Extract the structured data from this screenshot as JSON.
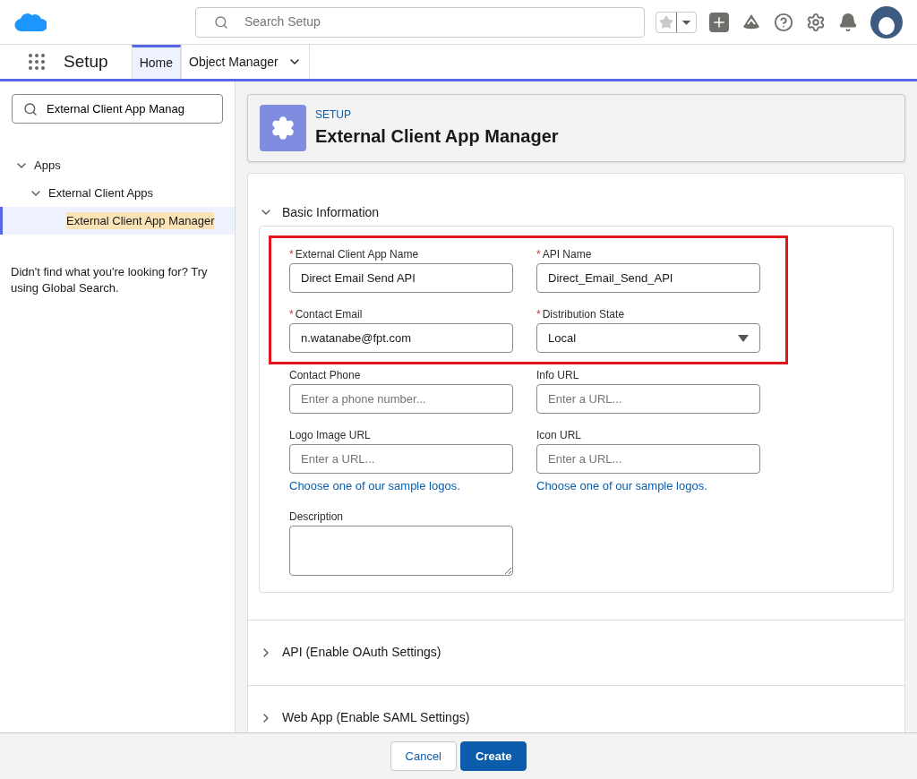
{
  "header": {
    "search": {
      "placeholder": "Search Setup"
    }
  },
  "nav": {
    "app_name": "Setup",
    "tabs": [
      {
        "label": "Home",
        "selected": true,
        "has_menu": false
      },
      {
        "label": "Object Manager",
        "selected": false,
        "has_menu": true
      }
    ]
  },
  "sidebar": {
    "search": {
      "value": "External Client App Manag"
    },
    "tree": [
      {
        "label": "Apps",
        "expanded": true,
        "selected": false,
        "children": [
          {
            "label": "External Client Apps",
            "expanded": true,
            "selected": false,
            "children": [
              {
                "label": "External Client App Manager",
                "selected": true
              }
            ]
          }
        ]
      }
    ],
    "help_text": "Didn't find what you're looking for? Try using Global Search."
  },
  "page_header": {
    "eyebrow": "SETUP",
    "title": "External Client App Manager"
  },
  "sections": [
    {
      "title": "Basic Information",
      "expanded": true,
      "groups": [
        {
          "highlighted": true,
          "rows": [
            [
              {
                "kind": "text",
                "label": "External Client App Name",
                "required_mark": "*",
                "value": "Direct Email Send API"
              },
              {
                "kind": "text",
                "label": "API Name",
                "required_mark": "*",
                "value": "Direct_Email_Send_API"
              }
            ],
            [
              {
                "kind": "text",
                "label": "Contact Email",
                "required_mark": "*",
                "value": "n.watanabe@fpt.com"
              },
              {
                "kind": "select",
                "label": "Distribution State",
                "required_mark": "*",
                "value": "Local"
              }
            ]
          ]
        },
        {
          "highlighted": false,
          "rows": [
            [
              {
                "kind": "text",
                "label": "Contact Phone",
                "placeholder": "Enter a phone number..."
              },
              {
                "kind": "text",
                "label": "Info URL",
                "placeholder": "Enter a URL..."
              }
            ],
            [
              {
                "kind": "text",
                "label": "Logo Image URL",
                "placeholder": "Enter a URL...",
                "link": "Choose one of our sample logos."
              },
              {
                "kind": "text",
                "label": "Icon URL",
                "placeholder": "Enter a URL...",
                "link": "Choose one of our sample logos."
              }
            ],
            [
              {
                "kind": "textarea",
                "label": "Description"
              }
            ]
          ]
        }
      ]
    },
    {
      "title": "API (Enable OAuth Settings)",
      "expanded": false
    },
    {
      "title": "Web App (Enable SAML Settings)",
      "expanded": false
    }
  ],
  "footer": {
    "buttons": [
      {
        "label": "Cancel",
        "kind": "neutral"
      },
      {
        "label": "Create",
        "kind": "brand"
      }
    ]
  }
}
